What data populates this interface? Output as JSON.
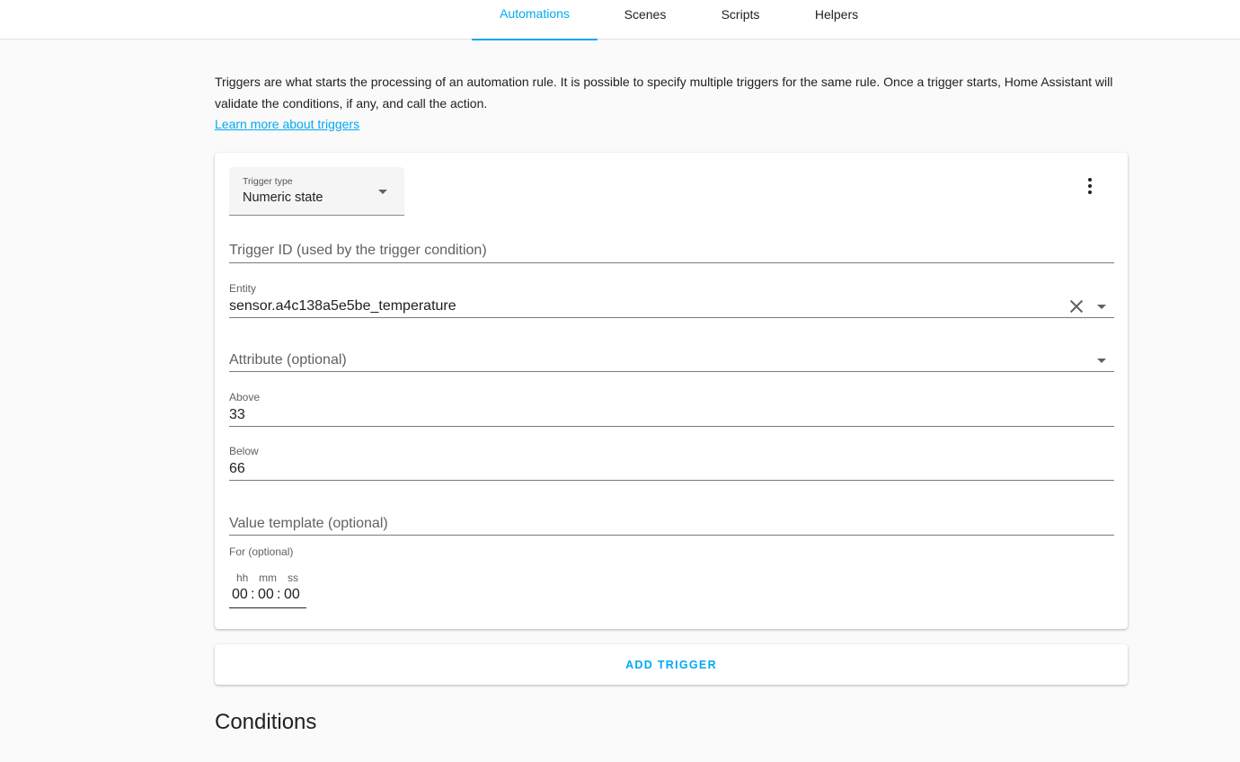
{
  "tabs": [
    {
      "label": "Automations",
      "active": true
    },
    {
      "label": "Scenes",
      "active": false
    },
    {
      "label": "Scripts",
      "active": false
    },
    {
      "label": "Helpers",
      "active": false
    }
  ],
  "intro": {
    "text": "Triggers are what starts the processing of an automation rule. It is possible to specify multiple triggers for the same rule. Once a trigger starts, Home Assistant will validate the conditions, if any, and call the action.",
    "link": "Learn more about triggers"
  },
  "trigger": {
    "type_label": "Trigger type",
    "type_value": "Numeric state",
    "trigger_id_placeholder": "Trigger ID (used by the trigger condition)",
    "entity_label": "Entity",
    "entity_value": "sensor.a4c138a5e5be_temperature",
    "attribute_placeholder": "Attribute (optional)",
    "above_label": "Above",
    "above_value": "33",
    "below_label": "Below",
    "below_value": "66",
    "value_template_placeholder": "Value template (optional)",
    "for_label": "For (optional)",
    "duration": {
      "hh_label": "hh",
      "mm_label": "mm",
      "ss_label": "ss",
      "hh": "00",
      "mm": "00",
      "ss": "00",
      "separator": ":"
    }
  },
  "add_trigger_label": "ADD TRIGGER",
  "conditions_title": "Conditions",
  "colors": {
    "accent": "#03a9f4",
    "text": "#212121",
    "background": "#fafafa"
  },
  "icons": [
    "more-vert-icon",
    "clear-icon",
    "dropdown-arrow-icon"
  ]
}
